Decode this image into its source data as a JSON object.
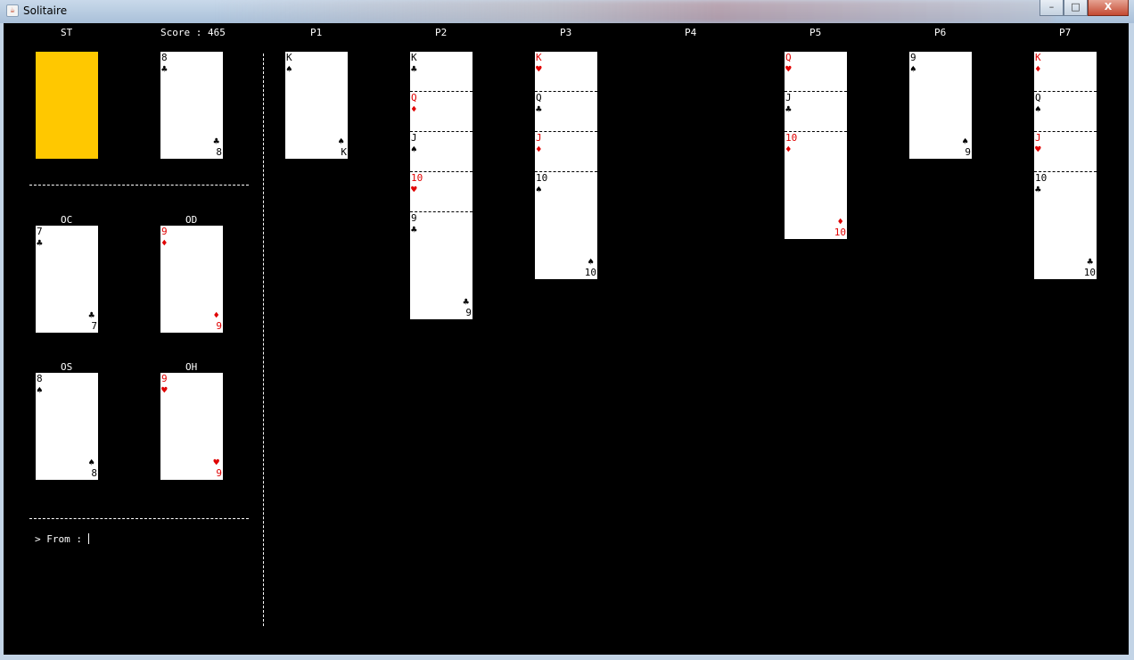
{
  "window": {
    "title": "Solitaire",
    "minimize": "–",
    "maximize": "□",
    "close": "X",
    "icon_name": "java-app-icon"
  },
  "colors": {
    "board": "#000000",
    "stock": "#ffc800",
    "red_suit": "#e00000",
    "black_suit": "#000000"
  },
  "header": {
    "stock_label": "ST",
    "score_text": "Score : 465",
    "pile_labels": [
      "P1",
      "P2",
      "P3",
      "P4",
      "P5",
      "P6",
      "P7"
    ]
  },
  "waste": {
    "rank": "8",
    "suit": "♣",
    "color": "black"
  },
  "foundations": [
    {
      "label": "OC",
      "rank": "7",
      "suit": "♣",
      "color": "black"
    },
    {
      "label": "OD",
      "rank": "9",
      "suit": "♦",
      "color": "red"
    },
    {
      "label": "OS",
      "rank": "8",
      "suit": "♠",
      "color": "black"
    },
    {
      "label": "OH",
      "rank": "9",
      "suit": "♥",
      "color": "red"
    }
  ],
  "piles": [
    {
      "name": "P1",
      "cards": [
        {
          "rank": "K",
          "suit": "♠",
          "color": "black"
        }
      ]
    },
    {
      "name": "P2",
      "cards": [
        {
          "rank": "K",
          "suit": "♣",
          "color": "black"
        },
        {
          "rank": "Q",
          "suit": "♦",
          "color": "red"
        },
        {
          "rank": "J",
          "suit": "♠",
          "color": "black"
        },
        {
          "rank": "10",
          "suit": "♥",
          "color": "red"
        },
        {
          "rank": "9",
          "suit": "♣",
          "color": "black"
        }
      ]
    },
    {
      "name": "P3",
      "cards": [
        {
          "rank": "K",
          "suit": "♥",
          "color": "red"
        },
        {
          "rank": "Q",
          "suit": "♣",
          "color": "black"
        },
        {
          "rank": "J",
          "suit": "♦",
          "color": "red"
        },
        {
          "rank": "10",
          "suit": "♠",
          "color": "black"
        }
      ]
    },
    {
      "name": "P4",
      "cards": []
    },
    {
      "name": "P5",
      "cards": [
        {
          "rank": "Q",
          "suit": "♥",
          "color": "red"
        },
        {
          "rank": "J",
          "suit": "♣",
          "color": "black"
        },
        {
          "rank": "10",
          "suit": "♦",
          "color": "red"
        }
      ]
    },
    {
      "name": "P6",
      "cards": [
        {
          "rank": "9",
          "suit": "♠",
          "color": "black"
        }
      ]
    },
    {
      "name": "P7",
      "cards": [
        {
          "rank": "K",
          "suit": "♦",
          "color": "red"
        },
        {
          "rank": "Q",
          "suit": "♠",
          "color": "black"
        },
        {
          "rank": "J",
          "suit": "♥",
          "color": "red"
        },
        {
          "rank": "10",
          "suit": "♣",
          "color": "black"
        }
      ]
    }
  ],
  "prompt": {
    "text": "> From : ",
    "value": ""
  }
}
